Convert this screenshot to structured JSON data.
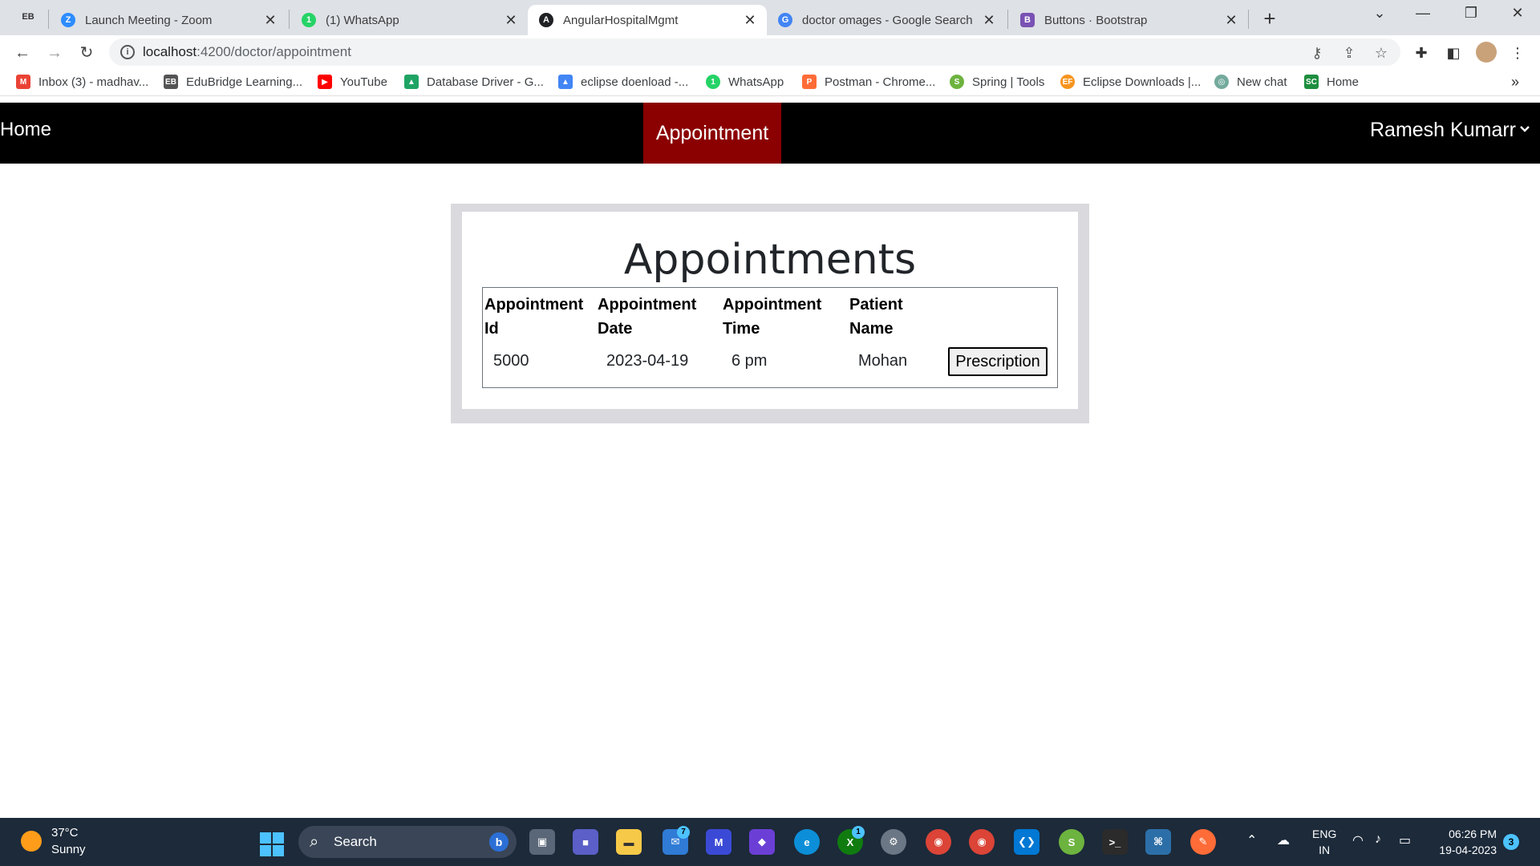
{
  "browser": {
    "tabs": [
      {
        "title": "Launch Meeting - Zoom",
        "icon": "zoom-icon",
        "color": "#2d8cff",
        "glyph": "Z"
      },
      {
        "title": "(1) WhatsApp",
        "icon": "whatsapp-icon",
        "color": "#25d366",
        "glyph": "1"
      },
      {
        "title": "AngularHospitalMgmt",
        "icon": "angular-icon",
        "color": "#202124",
        "glyph": "A"
      },
      {
        "title": "doctor omages - Google Search",
        "icon": "google-icon",
        "color": "#4285f4",
        "glyph": "G"
      },
      {
        "title": "Buttons · Bootstrap",
        "icon": "bootstrap-icon",
        "color": "#7952b3",
        "glyph": "B"
      }
    ],
    "pinned_glyph": "EB",
    "url_host": "localhost",
    "url_rest": ":4200/doctor/appointment",
    "bookmarks": [
      {
        "label": "Inbox (3) - madhav...",
        "icon": "gmail-icon",
        "color": "#ea4335",
        "glyph": "M"
      },
      {
        "label": "EduBridge Learning...",
        "icon": "edubridge-icon",
        "color": "#555555",
        "glyph": "EB"
      },
      {
        "label": "YouTube",
        "icon": "youtube-icon",
        "color": "#ff0000",
        "glyph": "▶"
      },
      {
        "label": "Database Driver - G...",
        "icon": "drive-icon",
        "color": "#1fa463",
        "glyph": "▲"
      },
      {
        "label": "eclipse doenload -...",
        "icon": "drive-icon",
        "color": "#4285f4",
        "glyph": "▲"
      },
      {
        "label": "WhatsApp",
        "icon": "whatsapp-icon",
        "color": "#25d366",
        "glyph": "1"
      },
      {
        "label": "Postman - Chrome...",
        "icon": "postman-icon",
        "color": "#ff6c37",
        "glyph": "P"
      },
      {
        "label": "Spring | Tools",
        "icon": "spring-icon",
        "color": "#6db33f",
        "glyph": "S"
      },
      {
        "label": "Eclipse Downloads |...",
        "icon": "eclipse-icon",
        "color": "#f7941e",
        "glyph": "EF"
      },
      {
        "label": "New chat",
        "icon": "chatgpt-icon",
        "color": "#74aa9c",
        "glyph": "◎"
      },
      {
        "label": "Home",
        "icon": "sc-icon",
        "color": "#1e8e3e",
        "glyph": "SC"
      }
    ]
  },
  "app": {
    "nav": {
      "home": "Home",
      "appointment": "Appointment",
      "user": "Ramesh Kumarr"
    },
    "title": "Appointments",
    "columns": [
      "Appointment Id",
      "Appointment Date",
      "Appointment Time",
      "Patient Name"
    ],
    "rows": [
      {
        "id": "5000",
        "date": "2023-04-19",
        "time": "6 pm",
        "patient": "Mohan",
        "action": "Prescription"
      }
    ]
  },
  "taskbar": {
    "weather_temp": "37°C",
    "weather_desc": "Sunny",
    "search_label": "Search",
    "lang_top": "ENG",
    "lang_bottom": "IN",
    "time": "06:26 PM",
    "date": "19-04-2023",
    "notifications": "3",
    "mail_badge": "7",
    "xbox_badge": "1"
  }
}
